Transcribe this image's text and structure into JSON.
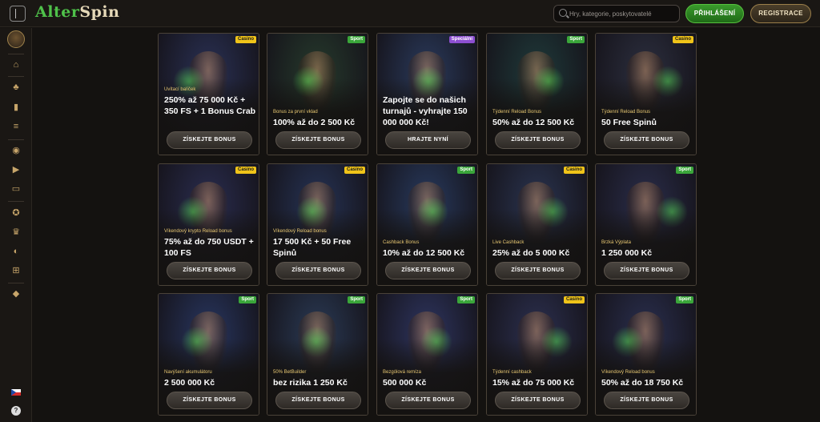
{
  "header": {
    "logo_part1": "Alter",
    "logo_part2": "Spin",
    "search_placeholder": "Hry, kategorie, poskytovatelé",
    "login_label": "PŘIHLÁŠENÍ",
    "register_label": "REGISTRACE"
  },
  "sidebar": {
    "items": [
      "home",
      "cherry",
      "card",
      "slots",
      "chip",
      "video",
      "table",
      "medal",
      "trophy",
      "planet",
      "cart",
      "diamond"
    ],
    "help_label": "?"
  },
  "colors": {
    "accent_green": "#3a9a2c",
    "gold": "#e8c872",
    "casino_badge": "#f0c419",
    "sport_badge": "#3aa63a",
    "special_badge": "#8d4fd1"
  },
  "cards": [
    {
      "badge": "Casino",
      "badge_type": "casino",
      "subtitle": "Uvítací balíček",
      "title": "250% až 75 000 Kč + 350 FS + 1 Bonus Crab",
      "button": "ZÍSKEJTE BONUS",
      "bg": "#2a3155"
    },
    {
      "badge": "Sport",
      "badge_type": "sport",
      "subtitle": "Bonus za první vklad",
      "title": "100% až do 2 500 Kč",
      "button": "ZÍSKEJTE BONUS",
      "bg": "#263a2c"
    },
    {
      "badge": "Speciální",
      "badge_type": "special",
      "subtitle": "",
      "title": "Zapojte se do našich turnajů - vyhrajte 150 000 000 Kč!",
      "button": "HRAJTE NYNÍ",
      "bg": "#2a3a5c"
    },
    {
      "badge": "Sport",
      "badge_type": "sport",
      "subtitle": "Týdenní Reload Bonus",
      "title": "50% až do 12 500 Kč",
      "button": "ZÍSKEJTE BONUS",
      "bg": "#1f3a3a"
    },
    {
      "badge": "Casino",
      "badge_type": "casino",
      "subtitle": "Týdenní Reload Bonus",
      "title": "50 Free Spinů",
      "button": "ZÍSKEJTE BONUS",
      "bg": "#2c2f3f"
    },
    {
      "badge": "Casino",
      "badge_type": "casino",
      "subtitle": "Víkendový krypto Reload bonus",
      "title": "75% až do 750 USDT + 100 FS",
      "button": "ZÍSKEJTE BONUS",
      "bg": "#2a2d50"
    },
    {
      "badge": "Casino",
      "badge_type": "casino",
      "subtitle": "Víkendový Reload bonus",
      "title": "17 500 Kč + 50 Free Spinů",
      "button": "ZÍSKEJTE BONUS",
      "bg": "#263355"
    },
    {
      "badge": "Sport",
      "badge_type": "sport",
      "subtitle": "Cashback Bonus",
      "title": "10% až do 12 500 Kč",
      "button": "ZÍSKEJTE BONUS",
      "bg": "#283a5e"
    },
    {
      "badge": "Casino",
      "badge_type": "casino",
      "subtitle": "Live Cashback",
      "title": "25% až do 5 000 Kč",
      "button": "ZÍSKEJTE BONUS",
      "bg": "#2a3450"
    },
    {
      "badge": "Sport",
      "badge_type": "sport",
      "subtitle": "Brzká Výplata",
      "title": "1 250 000 Kč",
      "button": "ZÍSKEJTE BONUS",
      "bg": "#2a2d4a"
    },
    {
      "badge": "Sport",
      "badge_type": "sport",
      "subtitle": "Navýšení akumulátoru",
      "title": "2 500 000 Kč",
      "button": "ZÍSKEJTE BONUS",
      "bg": "#283660"
    },
    {
      "badge": "Sport",
      "badge_type": "sport",
      "subtitle": "50% BetBuilder",
      "title": "bez rizika 1 250 Kč",
      "button": "ZÍSKEJTE BONUS",
      "bg": "#2a3a55"
    },
    {
      "badge": "Sport",
      "badge_type": "sport",
      "subtitle": "Bezgólová remíza",
      "title": "500 000 Kč",
      "button": "ZÍSKEJTE BONUS",
      "bg": "#2e3560"
    },
    {
      "badge": "Casino",
      "badge_type": "casino",
      "subtitle": "Týdenní cashback",
      "title": "15% až do 75 000 Kč",
      "button": "ZÍSKEJTE BONUS",
      "bg": "#2c3050"
    },
    {
      "badge": "Sport",
      "badge_type": "sport",
      "subtitle": "Víkendový Reload bonus",
      "title": "50% až do 18 750 Kč",
      "button": "ZÍSKEJTE BONUS",
      "bg": "#2a2f4f"
    }
  ]
}
